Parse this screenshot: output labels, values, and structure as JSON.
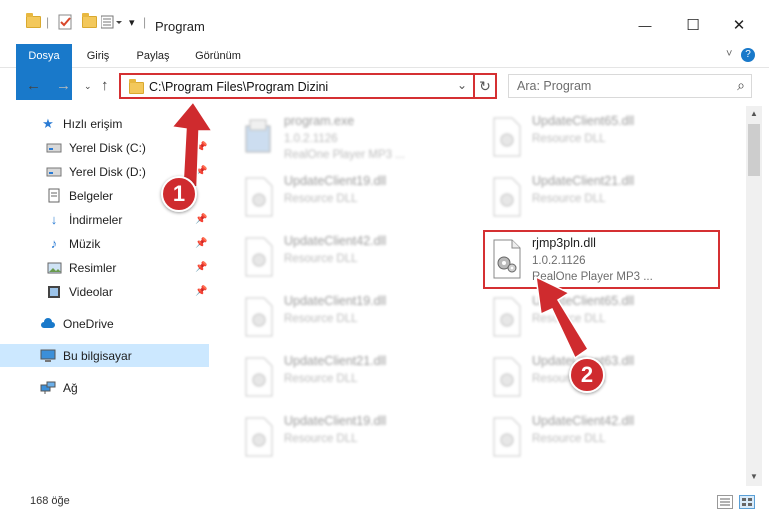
{
  "window": {
    "title": "Program",
    "minimize": "—",
    "maximize": "☐",
    "close": "✕"
  },
  "ribbon": {
    "tabs": [
      "Dosya",
      "Giriş",
      "Paylaş",
      "Görünüm"
    ],
    "collapse": "˅",
    "help": "?"
  },
  "address": {
    "path": "C:\\Program Files\\Program Dizini",
    "search_placeholder": "Ara: Program"
  },
  "nav": {
    "items": [
      {
        "label": "Hızlı erişim",
        "icon": "star-icon"
      },
      {
        "label": "Yerel Disk (C:)",
        "icon": "drive-icon"
      },
      {
        "label": "Yerel Disk (D:)",
        "icon": "drive-icon"
      },
      {
        "label": "Belgeler",
        "icon": "documents-icon"
      },
      {
        "label": "İndirmeler",
        "icon": "download-icon"
      },
      {
        "label": "Müzik",
        "icon": "music-icon"
      },
      {
        "label": "Resimler",
        "icon": "pictures-icon"
      },
      {
        "label": "Videolar",
        "icon": "video-icon"
      },
      {
        "label": "OneDrive",
        "icon": "cloud-icon"
      },
      {
        "label": "Bu bilgisayar",
        "icon": "computer-icon"
      },
      {
        "label": "Ağ",
        "icon": "network-icon"
      }
    ]
  },
  "files": [
    {
      "name": "program.exe",
      "line2": "1.0.2.1126",
      "line3": "RealOne Player MP3 ..."
    },
    {
      "name": "UpdateClient65.dll",
      "line2": "Resource DLL",
      "line3": ""
    },
    {
      "name": "UpdateClient19.dll",
      "line2": "Resource DLL",
      "line3": ""
    },
    {
      "name": "UpdateClient21.dll",
      "line2": "Resource DLL",
      "line3": ""
    },
    {
      "name": "UpdateClient42.dll",
      "line2": "Resource DLL",
      "line3": ""
    },
    {
      "name": "rjmp3pln.dll",
      "line2": "1.0.2.1126",
      "line3": "RealOne Player MP3 ..."
    },
    {
      "name": "UpdateClient19.dll",
      "line2": "Resource DLL",
      "line3": ""
    },
    {
      "name": "UpdateClient65.dll",
      "line2": "Resource DLL",
      "line3": ""
    },
    {
      "name": "UpdateClient21.dll",
      "line2": "Resource DLL",
      "line3": ""
    },
    {
      "name": "UpdateClient63.dll",
      "line2": "Resource DLL",
      "line3": ""
    },
    {
      "name": "UpdateClient19.dll",
      "line2": "Resource DLL",
      "line3": ""
    },
    {
      "name": "UpdateClient42.dll",
      "line2": "Resource DLL",
      "line3": ""
    }
  ],
  "status": {
    "count": "168 öğe"
  },
  "callouts": [
    "1",
    "2"
  ],
  "colors": {
    "accent": "#1979ca",
    "highlight": "#d53032",
    "selected": "#cce8ff"
  }
}
